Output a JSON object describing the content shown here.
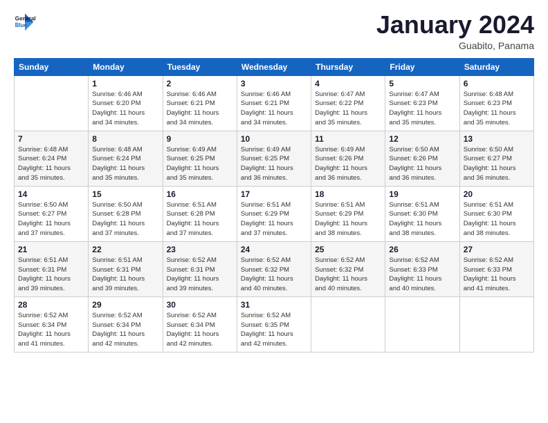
{
  "logo": {
    "line1": "General",
    "line2": "Blue"
  },
  "title": "January 2024",
  "subtitle": "Guabito, Panama",
  "days_header": [
    "Sunday",
    "Monday",
    "Tuesday",
    "Wednesday",
    "Thursday",
    "Friday",
    "Saturday"
  ],
  "weeks": [
    [
      {
        "num": "",
        "info": ""
      },
      {
        "num": "1",
        "info": "Sunrise: 6:46 AM\nSunset: 6:20 PM\nDaylight: 11 hours\nand 34 minutes."
      },
      {
        "num": "2",
        "info": "Sunrise: 6:46 AM\nSunset: 6:21 PM\nDaylight: 11 hours\nand 34 minutes."
      },
      {
        "num": "3",
        "info": "Sunrise: 6:46 AM\nSunset: 6:21 PM\nDaylight: 11 hours\nand 34 minutes."
      },
      {
        "num": "4",
        "info": "Sunrise: 6:47 AM\nSunset: 6:22 PM\nDaylight: 11 hours\nand 35 minutes."
      },
      {
        "num": "5",
        "info": "Sunrise: 6:47 AM\nSunset: 6:23 PM\nDaylight: 11 hours\nand 35 minutes."
      },
      {
        "num": "6",
        "info": "Sunrise: 6:48 AM\nSunset: 6:23 PM\nDaylight: 11 hours\nand 35 minutes."
      }
    ],
    [
      {
        "num": "7",
        "info": "Sunrise: 6:48 AM\nSunset: 6:24 PM\nDaylight: 11 hours\nand 35 minutes."
      },
      {
        "num": "8",
        "info": "Sunrise: 6:48 AM\nSunset: 6:24 PM\nDaylight: 11 hours\nand 35 minutes."
      },
      {
        "num": "9",
        "info": "Sunrise: 6:49 AM\nSunset: 6:25 PM\nDaylight: 11 hours\nand 35 minutes."
      },
      {
        "num": "10",
        "info": "Sunrise: 6:49 AM\nSunset: 6:25 PM\nDaylight: 11 hours\nand 36 minutes."
      },
      {
        "num": "11",
        "info": "Sunrise: 6:49 AM\nSunset: 6:26 PM\nDaylight: 11 hours\nand 36 minutes."
      },
      {
        "num": "12",
        "info": "Sunrise: 6:50 AM\nSunset: 6:26 PM\nDaylight: 11 hours\nand 36 minutes."
      },
      {
        "num": "13",
        "info": "Sunrise: 6:50 AM\nSunset: 6:27 PM\nDaylight: 11 hours\nand 36 minutes."
      }
    ],
    [
      {
        "num": "14",
        "info": "Sunrise: 6:50 AM\nSunset: 6:27 PM\nDaylight: 11 hours\nand 37 minutes."
      },
      {
        "num": "15",
        "info": "Sunrise: 6:50 AM\nSunset: 6:28 PM\nDaylight: 11 hours\nand 37 minutes."
      },
      {
        "num": "16",
        "info": "Sunrise: 6:51 AM\nSunset: 6:28 PM\nDaylight: 11 hours\nand 37 minutes."
      },
      {
        "num": "17",
        "info": "Sunrise: 6:51 AM\nSunset: 6:29 PM\nDaylight: 11 hours\nand 37 minutes."
      },
      {
        "num": "18",
        "info": "Sunrise: 6:51 AM\nSunset: 6:29 PM\nDaylight: 11 hours\nand 38 minutes."
      },
      {
        "num": "19",
        "info": "Sunrise: 6:51 AM\nSunset: 6:30 PM\nDaylight: 11 hours\nand 38 minutes."
      },
      {
        "num": "20",
        "info": "Sunrise: 6:51 AM\nSunset: 6:30 PM\nDaylight: 11 hours\nand 38 minutes."
      }
    ],
    [
      {
        "num": "21",
        "info": "Sunrise: 6:51 AM\nSunset: 6:31 PM\nDaylight: 11 hours\nand 39 minutes."
      },
      {
        "num": "22",
        "info": "Sunrise: 6:51 AM\nSunset: 6:31 PM\nDaylight: 11 hours\nand 39 minutes."
      },
      {
        "num": "23",
        "info": "Sunrise: 6:52 AM\nSunset: 6:31 PM\nDaylight: 11 hours\nand 39 minutes."
      },
      {
        "num": "24",
        "info": "Sunrise: 6:52 AM\nSunset: 6:32 PM\nDaylight: 11 hours\nand 40 minutes."
      },
      {
        "num": "25",
        "info": "Sunrise: 6:52 AM\nSunset: 6:32 PM\nDaylight: 11 hours\nand 40 minutes."
      },
      {
        "num": "26",
        "info": "Sunrise: 6:52 AM\nSunset: 6:33 PM\nDaylight: 11 hours\nand 40 minutes."
      },
      {
        "num": "27",
        "info": "Sunrise: 6:52 AM\nSunset: 6:33 PM\nDaylight: 11 hours\nand 41 minutes."
      }
    ],
    [
      {
        "num": "28",
        "info": "Sunrise: 6:52 AM\nSunset: 6:34 PM\nDaylight: 11 hours\nand 41 minutes."
      },
      {
        "num": "29",
        "info": "Sunrise: 6:52 AM\nSunset: 6:34 PM\nDaylight: 11 hours\nand 42 minutes."
      },
      {
        "num": "30",
        "info": "Sunrise: 6:52 AM\nSunset: 6:34 PM\nDaylight: 11 hours\nand 42 minutes."
      },
      {
        "num": "31",
        "info": "Sunrise: 6:52 AM\nSunset: 6:35 PM\nDaylight: 11 hours\nand 42 minutes."
      },
      {
        "num": "",
        "info": ""
      },
      {
        "num": "",
        "info": ""
      },
      {
        "num": "",
        "info": ""
      }
    ]
  ]
}
